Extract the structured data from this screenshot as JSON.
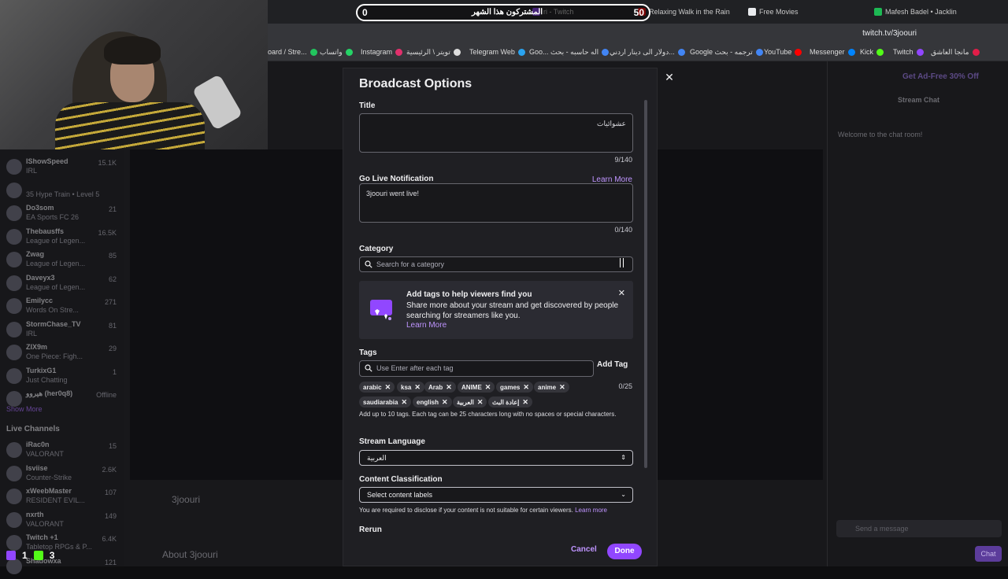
{
  "browser": {
    "tabs": [
      {
        "label": "ri - Twitch",
        "color": "#9146ff"
      },
      {
        "label": "Relaxing Walk in the Rain",
        "color": "#ff0000"
      },
      {
        "label": "Free Movies",
        "color": "#e8eaed"
      },
      {
        "label": "Mafesh Badel • Jacklin",
        "color": "#1db954"
      }
    ],
    "url": "twitch.tv/3joouri",
    "bookmarks": [
      {
        "label": "oard / Stre...",
        "color": "#22c55e"
      },
      {
        "label": "واتساب",
        "color": "#25d366"
      },
      {
        "label": "Instagram",
        "color": "#e1306c"
      },
      {
        "label": "تويتر \\ الرئيسية",
        "color": "#dddddd"
      },
      {
        "label": "Telegram Web",
        "color": "#2aa3ef"
      },
      {
        "label": "Goo... اله حاسبه - بحث",
        "color": "#4285f4"
      },
      {
        "label": "دولار الى دينار اردني...",
        "color": "#4285f4"
      },
      {
        "label": "Google ترجمه - بحث",
        "color": "#4285f4"
      },
      {
        "label": "YouTube",
        "color": "#ff0000"
      },
      {
        "label": "Messenger",
        "color": "#0084ff"
      },
      {
        "label": "Kick",
        "color": "#53fc18"
      },
      {
        "label": "Twitch",
        "color": "#9146ff"
      },
      {
        "label": "مانجا العاشق",
        "color": "#e11d48"
      }
    ]
  },
  "overlay": {
    "left_count": "0",
    "right_count": "50",
    "text": "المشتركون هذا الشهر"
  },
  "sidebar": {
    "channels": [
      {
        "name": "IShowSpeed",
        "game": "IRL",
        "viewers": "15.1K"
      },
      {
        "name": "",
        "game": "35 Hype Train • Level 5",
        "viewers": ""
      },
      {
        "name": "Do3som",
        "game": "EA Sports FC 26",
        "viewers": "21"
      },
      {
        "name": "Thebausffs",
        "game": "League of Legen...",
        "viewers": "16.5K"
      },
      {
        "name": "Zwag",
        "game": "League of Legen...",
        "viewers": "85"
      },
      {
        "name": "Daveyx3",
        "game": "League of Legen...",
        "viewers": "62"
      },
      {
        "name": "Emilycc",
        "game": "Words On Stre...",
        "viewers": "271"
      },
      {
        "name": "StormChase_TV",
        "game": "IRL",
        "viewers": "81"
      },
      {
        "name": "ZIX9m",
        "game": "One Piece: Figh...",
        "viewers": "29"
      },
      {
        "name": "TurkixG1",
        "game": "Just Chatting",
        "viewers": "1"
      },
      {
        "name": "هيروو (her0q8)",
        "game": "",
        "viewers": "Offline"
      }
    ],
    "show_more": "Show More",
    "live_channels_title": "Live Channels",
    "live": [
      {
        "name": "iRac0n",
        "game": "VALORANT",
        "viewers": "15"
      },
      {
        "name": "Isviise",
        "game": "Counter-Strike",
        "viewers": "2.6K"
      },
      {
        "name": "xWeebMaster",
        "game": "RESIDENT EVIL...",
        "viewers": "107"
      },
      {
        "name": "nxrth",
        "game": "VALORANT",
        "viewers": "149"
      },
      {
        "name": "Twitch +1",
        "game": "Tabletop RPGs & P...",
        "viewers": "6.4K"
      },
      {
        "name": "Shadowxa",
        "game": "",
        "viewers": "121"
      }
    ]
  },
  "background": {
    "stream_chat": "Stream Chat",
    "welcome": "Welcome to the chat room!",
    "ad_free": "Get Ad-Free 30% Off",
    "send_placeholder": "Send a message",
    "chat_button": "Chat",
    "channel_name": "3joouri",
    "about": "About 3joouri",
    "count_a": "1",
    "count_b": "3"
  },
  "modal": {
    "title": "Broadcast Options",
    "title_label": "Title",
    "title_value": "عشوائيات",
    "title_counter": "9/140",
    "notif_label": "Go Live Notification",
    "learn_more": "Learn More",
    "notif_value": "3joouri went live!",
    "notif_counter": "0/140",
    "category_label": "Category",
    "category_placeholder": "Search for a category",
    "promo_title": "Add tags to help viewers find you",
    "promo_body": "Share more about your stream and get discovered by people searching for streamers like you.",
    "promo_link": "Learn More",
    "tags_label": "Tags",
    "tags_placeholder": "Use Enter after each tag",
    "add_tag": "Add Tag",
    "tag_count": "0/25",
    "tags": [
      "arabic",
      "ksa",
      "Arab",
      "ANIME",
      "games",
      "anime",
      "saudiarabia",
      "english",
      "العربية",
      "إعادة البث"
    ],
    "tags_help": "Add up to 10 tags. Each tag can be 25 characters long with no spaces or special characters.",
    "language_label": "Stream Language",
    "language_value": "العربية",
    "classification_label": "Content Classification",
    "classification_value": "Select content labels",
    "disclose_text": "You are required to disclose if your content is not suitable for certain viewers.",
    "disclose_link": "Learn more",
    "rerun_label": "Rerun",
    "cancel": "Cancel",
    "done": "Done"
  },
  "colors": {
    "accent": "#9147ff",
    "link": "#bf94ff",
    "modal_bg": "#1f1f23"
  }
}
